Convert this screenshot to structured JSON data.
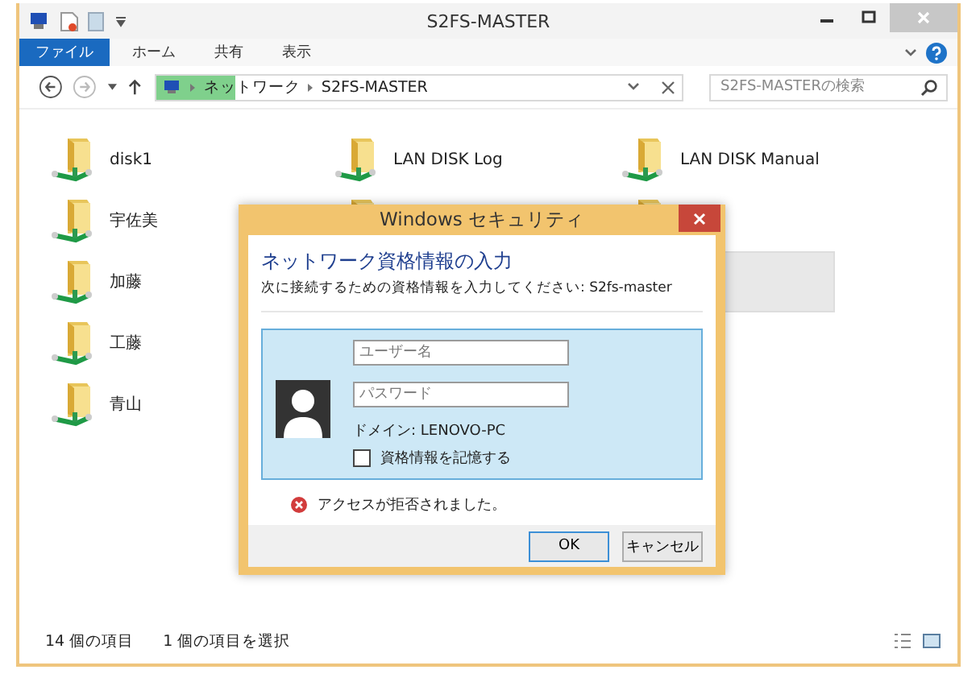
{
  "window": {
    "title": "S2FS-MASTER"
  },
  "ribbon_tabs": [
    {
      "label": "ファイル",
      "selected": true
    },
    {
      "label": "ホーム",
      "selected": false
    },
    {
      "label": "共有",
      "selected": false
    },
    {
      "label": "表示",
      "selected": false
    }
  ],
  "address_bar": {
    "path": [
      "ネットワーク",
      "S2FS-MASTER"
    ],
    "level": 0.15
  },
  "search": {
    "placeholder": "S2FS-MASTERの検索"
  },
  "items": [
    {
      "kind": "folder",
      "label": "disk1",
      "selected": false
    },
    {
      "kind": "folder",
      "label": "LAN DISK Log",
      "selected": false
    },
    {
      "kind": "folder",
      "label": "LAN DISK Manual",
      "selected": false
    },
    {
      "kind": "folder",
      "label": "宇佐美",
      "selected": false
    },
    {
      "kind": "folder",
      "selected": false
    },
    {
      "kind": "folder",
      "selected": false
    },
    {
      "kind": "folder",
      "label": "加藤",
      "selected": false
    },
    {
      "kind": "covered"
    },
    {
      "kind": "covered",
      "selected": true
    },
    {
      "kind": "folder",
      "label": "工藤",
      "selected": false
    },
    {
      "kind": "covered"
    },
    {
      "kind": "covered"
    },
    {
      "kind": "folder",
      "label": "青山",
      "selected": false
    }
  ],
  "status_bar": {
    "item_count": "14 個の項目",
    "selection": "1 個の項目を選択"
  },
  "dialog": {
    "title": "Windows セキュリティ",
    "heading": "ネットワーク資格情報の入力",
    "prompt": "次に接続するための資格情報を入力してください: S2fs-master",
    "username": {
      "placeholder": "ユーザー名"
    },
    "password": {
      "placeholder": "パスワード"
    },
    "domain": "ドメイン: LENOVO-PC",
    "remember": {
      "label": "資格情報を記憶する",
      "checked": false
    },
    "error": "アクセスが拒否されました。",
    "buttons": [
      "OK",
      "キャンセル"
    ]
  }
}
